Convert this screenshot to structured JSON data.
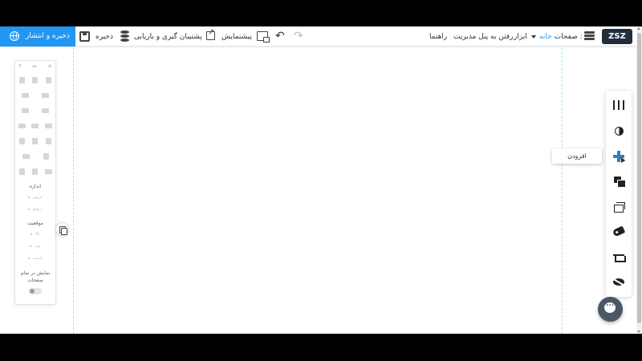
{
  "toolbar": {
    "publish_label": "ذخیره و انتشار",
    "save_label": "ذخیره",
    "backup_label": "پشتیبان گیری و بازیابی",
    "preview_label": "پیشنمایش",
    "help_label": "راهنما",
    "admin_label": "رفتن به پنل مدیریت",
    "tools_label": "ابزار",
    "pages_label": "صفحات :",
    "current_page": "خانه",
    "logo_text": "ZSZ"
  },
  "props_panel": {
    "size_title": "اندازه",
    "width_label": "عرض",
    "height_label": "ارتفاع",
    "position_title": "موقعیت",
    "top_label": "بالا",
    "left_label": "چپ",
    "right_label": "راست",
    "show_all_label": "نمایش در تمام صفحات"
  },
  "right_toolbar": {
    "tooltip": "افزودن"
  },
  "colors": {
    "accent": "#2196f3",
    "publish_bg": "#2196f3",
    "guide": "#b7e3cf",
    "chat_bg": "#4a5866"
  }
}
